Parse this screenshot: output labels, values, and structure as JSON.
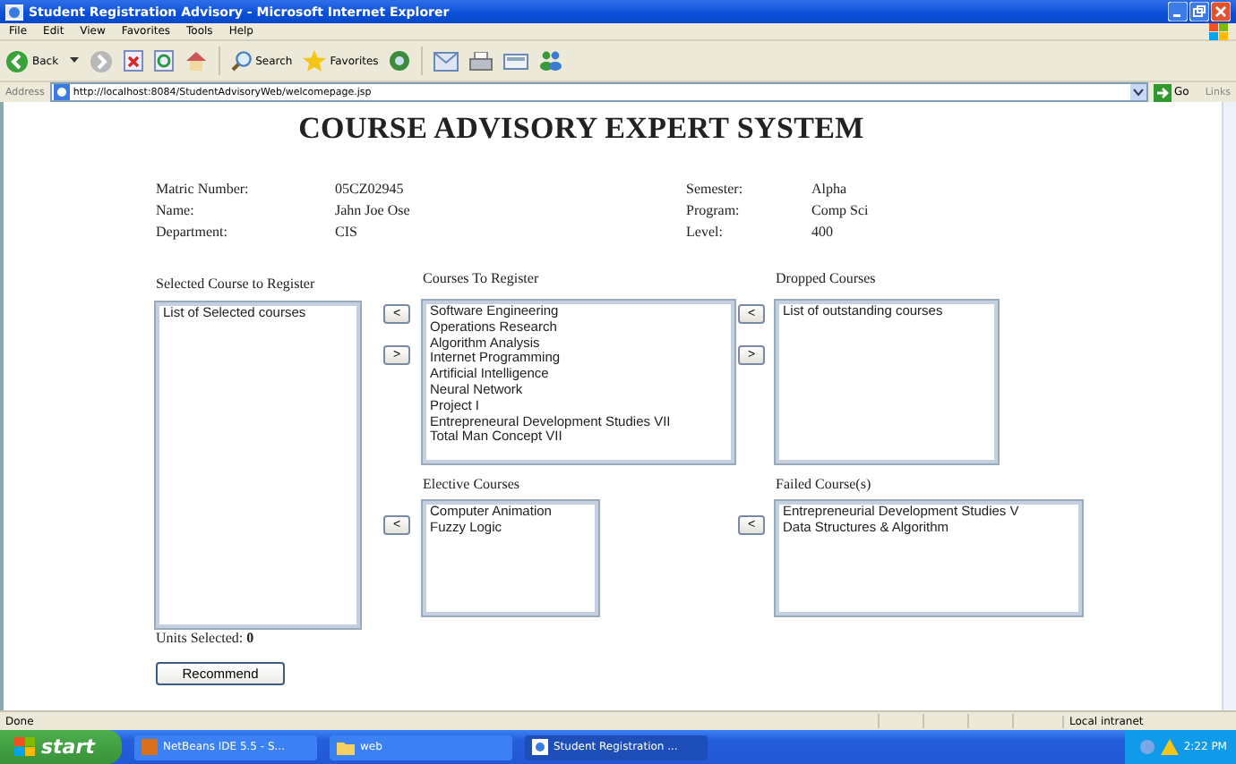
{
  "window": {
    "title": "Student Registration Advisory - Microsoft Internet Explorer"
  },
  "menu": [
    "File",
    "Edit",
    "View",
    "Favorites",
    "Tools",
    "Help"
  ],
  "toolbar": {
    "back": "Back",
    "search": "Search",
    "favorites": "Favorites"
  },
  "address": {
    "label": "Address",
    "url": "http://localhost:8084/StudentAdvisoryWeb/welcomepage.jsp",
    "go": "Go",
    "links": "Links"
  },
  "page": {
    "title": "COURSE ADVISORY EXPERT SYSTEM",
    "info_left": [
      {
        "label": "Matric Number:",
        "value": "05CZ02945"
      },
      {
        "label": "Name:",
        "value": "Jahn Joe Ose"
      },
      {
        "label": "Department:",
        "value": "CIS"
      }
    ],
    "info_right": [
      {
        "label": "Semester:",
        "value": "Alpha"
      },
      {
        "label": "Program:",
        "value": "Comp Sci"
      },
      {
        "label": "Level:",
        "value": "400"
      }
    ],
    "selected_courses": {
      "heading": "Selected Course to Register",
      "items": [
        "List of Selected courses"
      ]
    },
    "courses_to_register": {
      "heading": "Courses To Register",
      "buttons": [
        "<",
        ">"
      ],
      "items": [
        "Software Engineering",
        "Operations Research",
        "Algorithm Analysis",
        "Internet Programming",
        "Artificial Intelligence",
        "Neural Network",
        "Project I",
        "Entrepreneural Development Studies VII",
        "Total Man Concept VII"
      ]
    },
    "dropped_courses": {
      "heading": "Dropped Courses",
      "buttons": [
        "<",
        ">"
      ],
      "items": [
        "List of outstanding courses"
      ]
    },
    "elective_courses": {
      "heading": "Elective Courses",
      "buttons": [
        "<"
      ],
      "items": [
        "Computer Animation",
        "Fuzzy Logic"
      ]
    },
    "failed_courses": {
      "heading": "Failed Course(s)",
      "buttons": [
        "<"
      ],
      "items": [
        "Entrepreneurial Development Studies V",
        "Data Structures & Algorithm"
      ]
    },
    "units": "Units Selected: **0**",
    "recommend": "Recommend"
  },
  "status_bar": {
    "status": "Done",
    "zone": "Local intranet"
  },
  "taskbar": {
    "start": "start",
    "tasks": [
      {
        "label": "NetBeans IDE 5.5 - S...",
        "kind": "app",
        "selected": false
      },
      {
        "label": "web",
        "kind": "folder",
        "selected": false
      },
      {
        "label": "Student Registration ...",
        "kind": "browser",
        "selected": true
      }
    ],
    "clock": "2:22 PM"
  }
}
